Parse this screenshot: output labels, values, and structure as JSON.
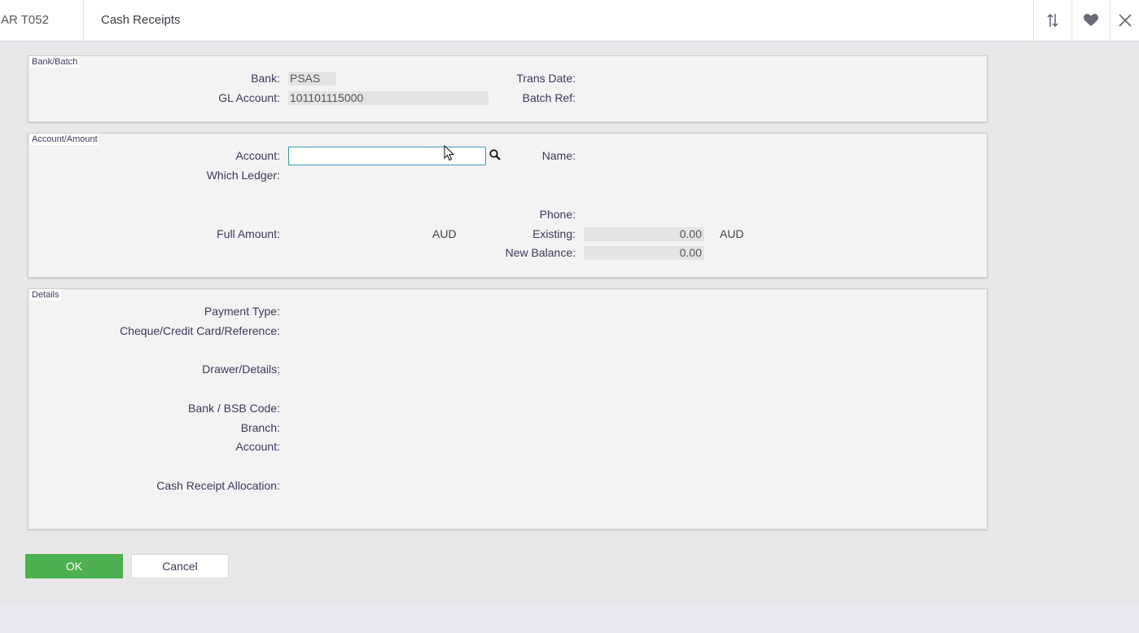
{
  "header": {
    "code": "AR T052",
    "title": "Cash Receipts",
    "icons": [
      "sort-arrows-icon",
      "heart-icon",
      "close-icon"
    ]
  },
  "bank_batch": {
    "title": "Bank/Batch",
    "bank_label": "Bank:",
    "bank_value": "PSAS",
    "gl_account_label": "GL Account:",
    "gl_account_value": "101101115000",
    "trans_date_label": "Trans Date:",
    "batch_ref_label": "Batch Ref:"
  },
  "account_amount": {
    "title": "Account/Amount",
    "account_label": "Account:",
    "account_value": "",
    "name_label": "Name:",
    "which_ledger_label": "Which Ledger:",
    "phone_label": "Phone:",
    "full_amount_label": "Full Amount:",
    "full_amount_currency": "AUD",
    "existing_label": "Existing:",
    "existing_value": "0.00",
    "existing_currency": "AUD",
    "new_balance_label": "New Balance:",
    "new_balance_value": "0.00"
  },
  "details": {
    "title": "Details",
    "payment_type_label": "Payment Type:",
    "reference_label": "Cheque/Credit Card/Reference:",
    "drawer_label": "Drawer/Details:",
    "bsb_label": "Bank / BSB Code:",
    "branch_label": "Branch:",
    "account_label": "Account:",
    "allocation_label": "Cash Receipt Allocation:"
  },
  "actions": {
    "ok_label": "OK",
    "cancel_label": "Cancel"
  }
}
